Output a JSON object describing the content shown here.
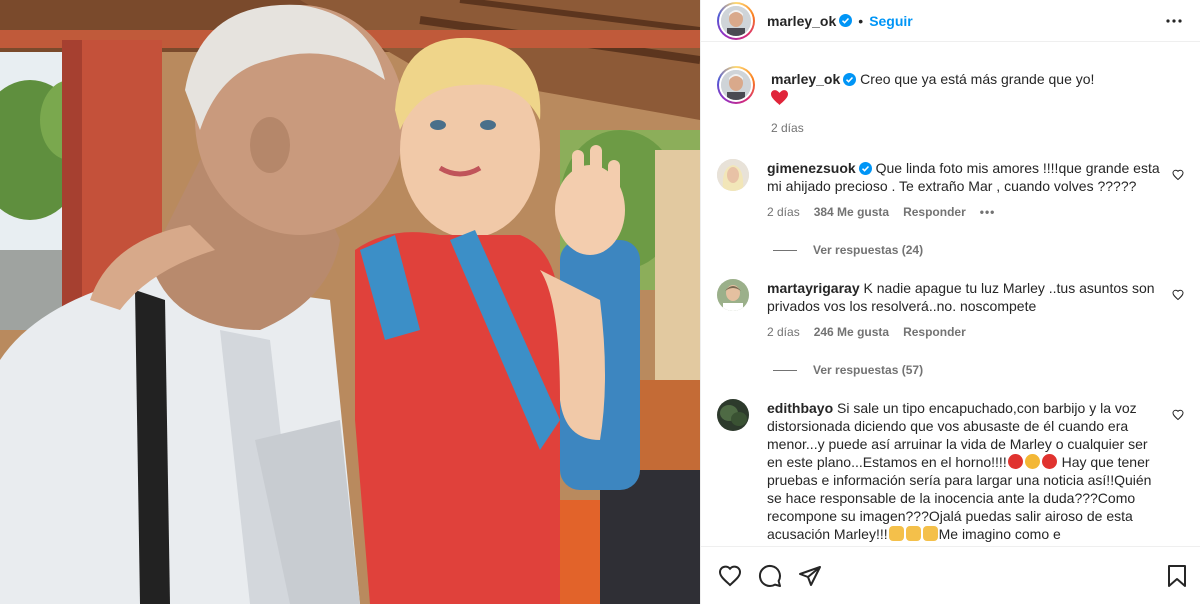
{
  "header": {
    "username": "marley_ok",
    "separator": "•",
    "follow_label": "Seguir"
  },
  "caption": {
    "username": "marley_ok",
    "text": "Creo que ya está más grande que yo!",
    "emoji": "❤️",
    "time": "2 días"
  },
  "comments": [
    {
      "username": "gimenezsuok",
      "verified": true,
      "text": "Que linda foto mis amores !!!!que grande esta mi ahijado precioso . Te extraño Mar , cuando volves ?????",
      "time": "2 días",
      "likes": "384 Me gusta",
      "reply_label": "Responder",
      "options_label": "•••",
      "view_replies": "Ver respuestas (24)"
    },
    {
      "username": "martayrigaray",
      "verified": false,
      "text": "K nadie apague tu luz Marley ..tus asuntos son privados vos los resolverá..no. noscompete",
      "time": "2 días",
      "likes": "246 Me gusta",
      "reply_label": "Responder",
      "view_replies": "Ver respuestas (57)"
    },
    {
      "username": "edithbayo",
      "verified": false,
      "text_a": "Si sale un tipo encapuchado,con barbijo y la voz distorsionada diciendo que vos abusaste de él cuando era menor...y puede así arruinar la vida de Marley o cualquier ser en este plano...Estamos en el horno!!!!",
      "text_b": "Hay que tener pruebas e información sería para largar una noticia así!!Quién se hace responsable de la inocencia ante la duda???Como recompone su imagen???Ojalá puedas salir airoso de esta acusación Marley!!!",
      "text_c": "Me imagino como e"
    }
  ],
  "colors": {
    "link": "#0095f6",
    "verified": "#0095f6",
    "heart": "#ed4956",
    "text": "#262626",
    "muted": "#737373"
  },
  "icons": {
    "like": "heart-outline-icon",
    "comment": "comment-bubble-icon",
    "share": "paper-plane-icon",
    "save": "bookmark-icon"
  }
}
